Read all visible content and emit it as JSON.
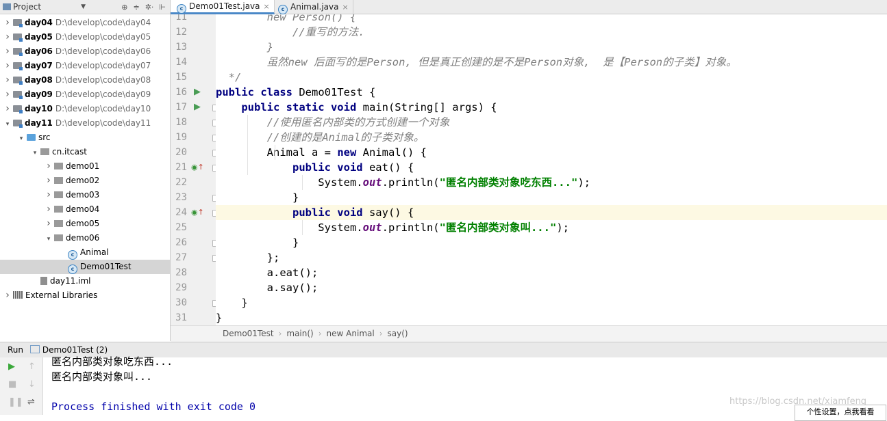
{
  "project_panel": {
    "title": "Project",
    "tree": [
      {
        "kind": "module",
        "name": "day04",
        "path": "D:\\develop\\code\\day04",
        "arrow": "›"
      },
      {
        "kind": "module",
        "name": "day05",
        "path": "D:\\develop\\code\\day05",
        "arrow": "›"
      },
      {
        "kind": "module",
        "name": "day06",
        "path": "D:\\develop\\code\\day06",
        "arrow": "›"
      },
      {
        "kind": "module",
        "name": "day07",
        "path": "D:\\develop\\code\\day07",
        "arrow": "›"
      },
      {
        "kind": "module",
        "name": "day08",
        "path": "D:\\develop\\code\\day08",
        "arrow": "›"
      },
      {
        "kind": "module",
        "name": "day09",
        "path": "D:\\develop\\code\\day09",
        "arrow": "›"
      },
      {
        "kind": "module",
        "name": "day10",
        "path": "D:\\develop\\code\\day10",
        "arrow": "›"
      },
      {
        "kind": "module",
        "name": "day11",
        "path": "D:\\develop\\code\\day11",
        "arrow": "⌄"
      },
      {
        "kind": "src",
        "name": "src",
        "arrow": "⌄"
      },
      {
        "kind": "package",
        "name": "cn.itcast",
        "arrow": "⌄"
      },
      {
        "kind": "package",
        "name": "demo01",
        "arrow": "›"
      },
      {
        "kind": "package",
        "name": "demo02",
        "arrow": "›"
      },
      {
        "kind": "package",
        "name": "demo03",
        "arrow": "›"
      },
      {
        "kind": "package",
        "name": "demo04",
        "arrow": "›"
      },
      {
        "kind": "package",
        "name": "demo05",
        "arrow": "›"
      },
      {
        "kind": "package",
        "name": "demo06",
        "arrow": "⌄"
      },
      {
        "kind": "class",
        "name": "Animal",
        "arrow": ""
      },
      {
        "kind": "class",
        "name": "Demo01Test",
        "arrow": "",
        "selected": true
      },
      {
        "kind": "iml",
        "name": "day11.iml",
        "arrow": ""
      },
      {
        "kind": "lib",
        "name": "External Libraries",
        "arrow": "›"
      }
    ]
  },
  "tabs": [
    {
      "label": "Demo01Test.java",
      "active": true
    },
    {
      "label": "Animal.java",
      "active": false
    }
  ],
  "editor": {
    "lines": [
      {
        "n": "11",
        "tokens": [
          [
            "        ",
            ""
          ],
          [
            "new Person() {",
            "cm"
          ]
        ]
      },
      {
        "n": "12",
        "tokens": [
          [
            "            ",
            ""
          ],
          [
            "//重写的方法.",
            "cm"
          ]
        ]
      },
      {
        "n": "13",
        "tokens": [
          [
            "        ",
            ""
          ],
          [
            "}",
            "cm"
          ]
        ]
      },
      {
        "n": "14",
        "tokens": [
          [
            "        ",
            ""
          ],
          [
            "虽然new 后面写的是Person, 但是真正创建的是不是Person对象,  是【Person的子类】对象。",
            "cm"
          ]
        ]
      },
      {
        "n": "15",
        "tokens": [
          [
            "  ",
            ""
          ],
          [
            "*/",
            "cm"
          ]
        ]
      },
      {
        "n": "16",
        "tokens": [
          [
            "public class ",
            "kw"
          ],
          [
            "Demo01Test {",
            ""
          ]
        ],
        "run": true
      },
      {
        "n": "17",
        "tokens": [
          [
            "    ",
            ""
          ],
          [
            "public static void ",
            "kw"
          ],
          [
            "main(String[] args) {",
            ""
          ]
        ],
        "run": true,
        "fold": true
      },
      {
        "n": "18",
        "tokens": [
          [
            "        ",
            ""
          ],
          [
            "//使用匿名内部类的方式创建一个对象",
            "cm"
          ]
        ],
        "fold": true
      },
      {
        "n": "19",
        "tokens": [
          [
            "        ",
            ""
          ],
          [
            "//创建的是Animal的子类对象。",
            "cm"
          ]
        ],
        "fold": true
      },
      {
        "n": "20",
        "tokens": [
          [
            "        Animal a = ",
            ""
          ],
          [
            "new ",
            "kw"
          ],
          [
            "Animal() {",
            ""
          ]
        ],
        "fold": true
      },
      {
        "n": "21",
        "tokens": [
          [
            "            ",
            ""
          ],
          [
            "public void ",
            "kw"
          ],
          [
            "eat() {",
            ""
          ]
        ],
        "override": true,
        "fold": true
      },
      {
        "n": "22",
        "tokens": [
          [
            "                System.",
            ""
          ],
          [
            "out",
            "fld"
          ],
          [
            ".println(",
            ""
          ],
          [
            "\"匿名内部类对象吃东西...\"",
            "str"
          ],
          [
            ");",
            ""
          ]
        ]
      },
      {
        "n": "23",
        "tokens": [
          [
            "            }",
            ""
          ]
        ],
        "fold": true
      },
      {
        "n": "24",
        "tokens": [
          [
            "            ",
            ""
          ],
          [
            "public void ",
            "kw"
          ],
          [
            "say() {",
            ""
          ]
        ],
        "override": true,
        "fold": true,
        "highlight": true
      },
      {
        "n": "25",
        "tokens": [
          [
            "                System.",
            ""
          ],
          [
            "out",
            "fld"
          ],
          [
            ".println(",
            ""
          ],
          [
            "\"匿名内部类对象叫...\"",
            "str"
          ],
          [
            ");",
            ""
          ]
        ]
      },
      {
        "n": "26",
        "tokens": [
          [
            "            }",
            ""
          ]
        ],
        "fold": true
      },
      {
        "n": "27",
        "tokens": [
          [
            "        };",
            ""
          ]
        ],
        "fold": true
      },
      {
        "n": "28",
        "tokens": [
          [
            "        a.eat();",
            ""
          ]
        ]
      },
      {
        "n": "29",
        "tokens": [
          [
            "        a.say();",
            ""
          ]
        ]
      },
      {
        "n": "30",
        "tokens": [
          [
            "    }",
            ""
          ]
        ],
        "fold": true
      },
      {
        "n": "31",
        "tokens": [
          [
            "}",
            ""
          ]
        ]
      }
    ]
  },
  "breadcrumb": [
    "Demo01Test",
    "main()",
    "new Animal",
    "say()"
  ],
  "run_panel": {
    "label": "Run",
    "config": "Demo01Test (2)",
    "output": [
      "匿名内部类对象吃东西...",
      "匿名内部类对象叫..."
    ],
    "exit_message": "Process finished with exit code 0"
  },
  "watermark": "https://blog.csdn.net/xiamfeng",
  "popup_text": "个性设置，点我看看",
  "colors": {
    "keyword": "#000080",
    "string": "#008000",
    "comment": "#808080",
    "field": "#660e7a",
    "accent": "#4a88c7"
  }
}
